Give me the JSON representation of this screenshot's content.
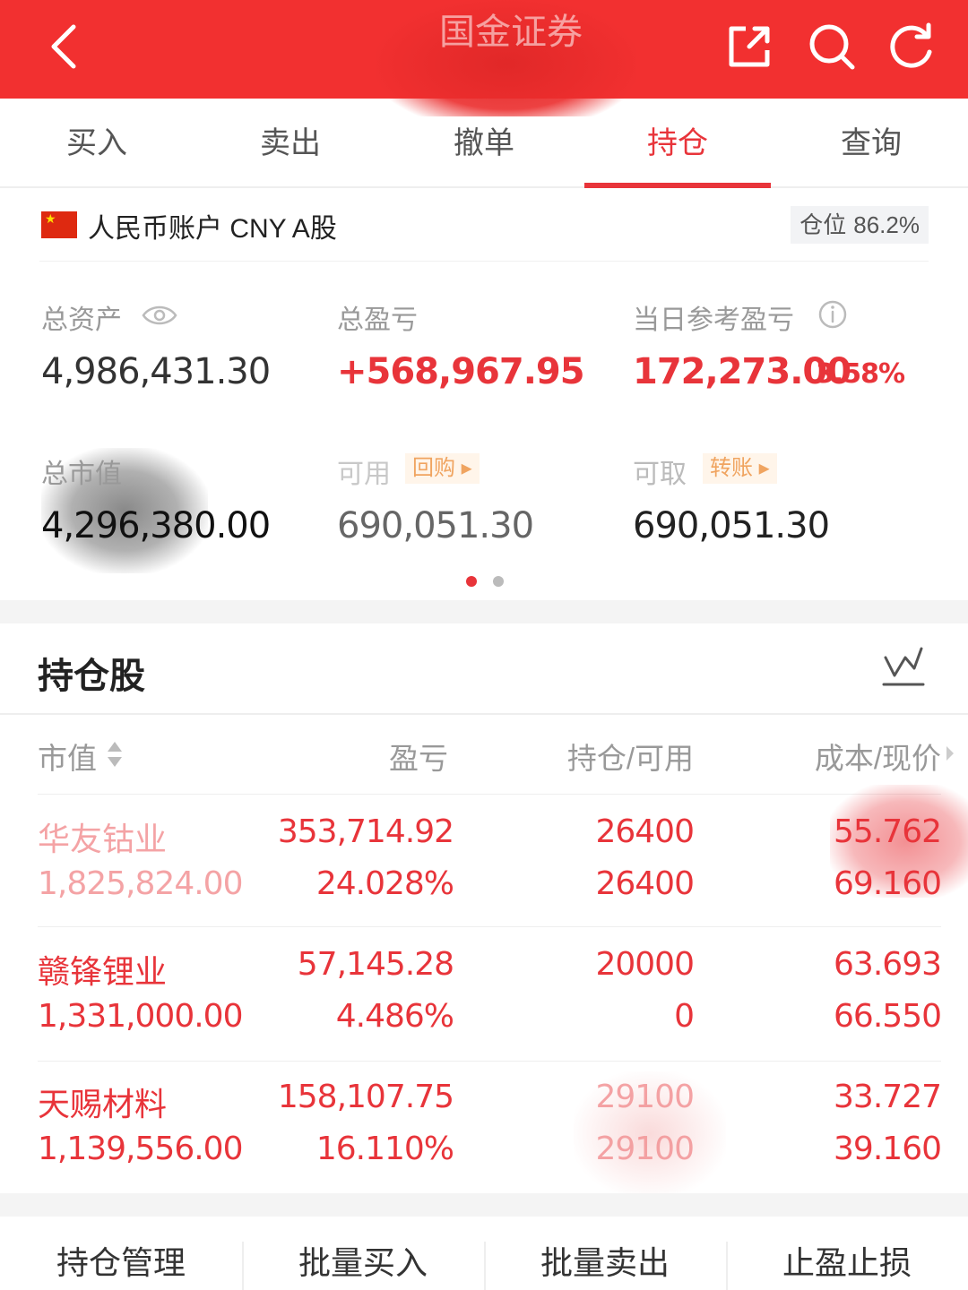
{
  "header": {
    "title": "国金证券",
    "accent": "#f23030",
    "icons": [
      "back-icon",
      "share-icon",
      "search-icon",
      "refresh-icon"
    ]
  },
  "tabs": [
    {
      "label": "买入",
      "active": false
    },
    {
      "label": "卖出",
      "active": false
    },
    {
      "label": "撤单",
      "active": false
    },
    {
      "label": "持仓",
      "active": true
    },
    {
      "label": "查询",
      "active": false
    }
  ],
  "account": {
    "label": "人民币账户 CNY A股",
    "position_label": "仓位",
    "position_value": "86.2%"
  },
  "stats": {
    "total_assets_label": "总资产",
    "total_assets_value": "4,986,431.30",
    "total_pnl_label": "总盈亏",
    "total_pnl_value": "+568,967.95",
    "daily_pnl_label": "当日参考盈亏",
    "daily_pnl_value": "172,273.00",
    "daily_pnl_pct": "3.58%",
    "market_value_label": "总市值",
    "market_value_value": "4,296,380.00",
    "available_label": "可用",
    "available_pill": "回购",
    "available_value": "690,051.30",
    "withdrawable_label": "可取",
    "withdrawable_pill": "转账",
    "withdrawable_value": "690,051.30"
  },
  "pager": {
    "count": 2,
    "active": 0
  },
  "holdings": {
    "title": "持仓股",
    "columns": {
      "market_value": "市值",
      "pnl": "盈亏",
      "position": "持仓/可用",
      "cost_price": "成本/现价"
    },
    "rows": [
      {
        "name": "华友钴业",
        "market_value": "1,825,824.00",
        "pnl": "353,714.92",
        "pnl_pct": "24.028%",
        "position": "26400",
        "available": "26400",
        "cost": "55.762",
        "price": "69.160"
      },
      {
        "name": "赣锋锂业",
        "market_value": "1,331,000.00",
        "pnl": "57,145.28",
        "pnl_pct": "4.486%",
        "position": "20000",
        "available": "0",
        "cost": "63.693",
        "price": "66.550"
      },
      {
        "name": "天赐材料",
        "market_value": "1,139,556.00",
        "pnl": "158,107.75",
        "pnl_pct": "16.110%",
        "position": "29100",
        "available": "29100",
        "cost": "33.727",
        "price": "39.160"
      }
    ]
  },
  "bottom_actions": [
    "持仓管理",
    "批量买入",
    "批量卖出",
    "止盈止损"
  ],
  "colors": {
    "gain": "#e8343a",
    "muted": "#999999",
    "active_tab": "#e8343a"
  }
}
